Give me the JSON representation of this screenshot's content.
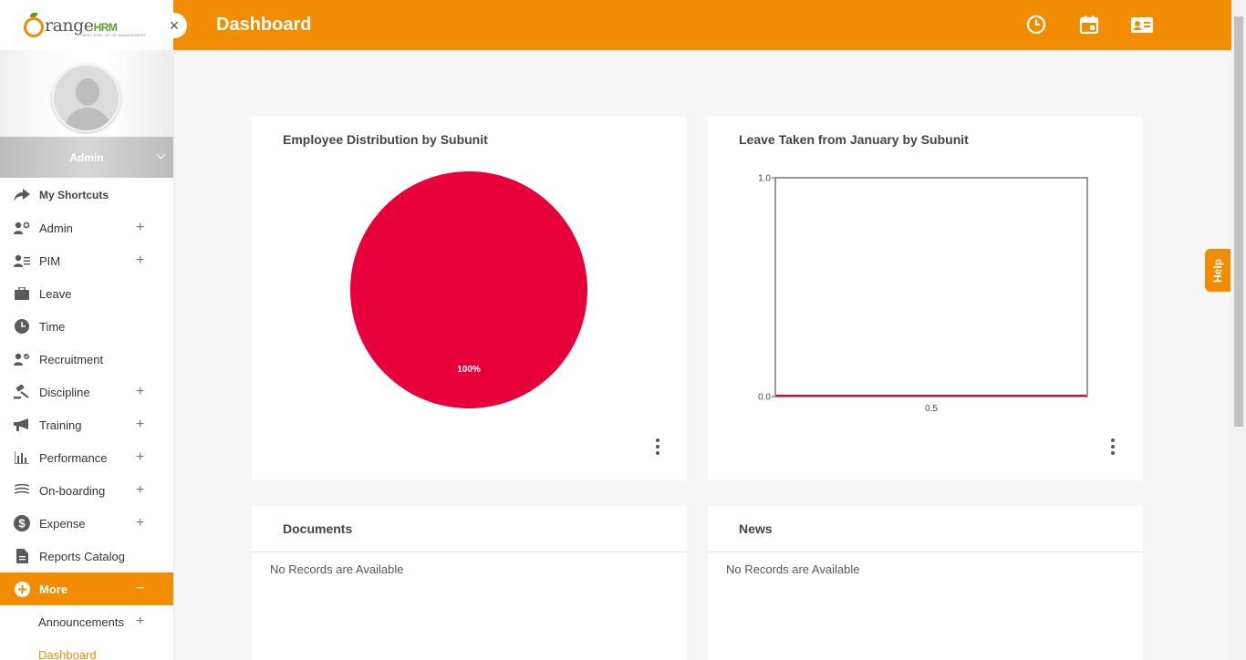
{
  "app": {
    "logo_main": "range",
    "logo_hrm": "HRM",
    "logo_tagline": "NEW LEVEL OF HR MANAGEMENT",
    "accent_color": "#f28c00"
  },
  "header": {
    "title": "Dashboard",
    "icons": [
      "clock-icon",
      "calendar-icon",
      "contact-card-icon"
    ]
  },
  "sidebar": {
    "user_name": "Admin",
    "items": [
      {
        "label": "My Shortcuts",
        "icon": "share-arrow-icon",
        "expandable": false
      },
      {
        "label": "Admin",
        "icon": "user-cog-icon",
        "expandable": true
      },
      {
        "label": "PIM",
        "icon": "user-list-icon",
        "expandable": true
      },
      {
        "label": "Leave",
        "icon": "briefcase-icon",
        "expandable": false
      },
      {
        "label": "Time",
        "icon": "clock-icon",
        "expandable": false
      },
      {
        "label": "Recruitment",
        "icon": "user-check-icon",
        "expandable": false
      },
      {
        "label": "Discipline",
        "icon": "gavel-icon",
        "expandable": true
      },
      {
        "label": "Training",
        "icon": "megaphone-icon",
        "expandable": true
      },
      {
        "label": "Performance",
        "icon": "bar-chart-icon",
        "expandable": true
      },
      {
        "label": "On-boarding",
        "icon": "layers-icon",
        "expandable": true
      },
      {
        "label": "Expense",
        "icon": "dollar-icon",
        "expandable": true
      },
      {
        "label": "Reports Catalog",
        "icon": "document-icon",
        "expandable": false
      },
      {
        "label": "More",
        "icon": "plus-circle-icon",
        "expandable": true,
        "expanded": true
      },
      {
        "label": "Announcements",
        "expandable": true
      },
      {
        "label": "Dashboard",
        "expandable": false
      }
    ],
    "plus_sign": "+",
    "minus_sign": "−"
  },
  "help": {
    "label": "Help"
  },
  "widgets": {
    "employee_distribution": {
      "title": "Employee Distribution by Subunit"
    },
    "leave_taken": {
      "title": "Leave Taken from January by Subunit"
    },
    "documents": {
      "title": "Documents",
      "empty_text": "No Records are Available"
    },
    "news": {
      "title": "News",
      "empty_text": "No Records are Available"
    }
  },
  "chart_data": [
    {
      "type": "pie",
      "title": "Employee Distribution by Subunit",
      "slices": [
        {
          "value": 100,
          "label": "100%",
          "color": "#e8003a"
        }
      ]
    },
    {
      "type": "bar",
      "title": "Leave Taken from January by Subunit",
      "ylim": [
        0.0,
        1.0
      ],
      "yticks": [
        "0.0",
        "1.0"
      ],
      "xticks": [
        "0.5"
      ],
      "values": [
        0
      ],
      "series_color": "#e8003a"
    }
  ]
}
